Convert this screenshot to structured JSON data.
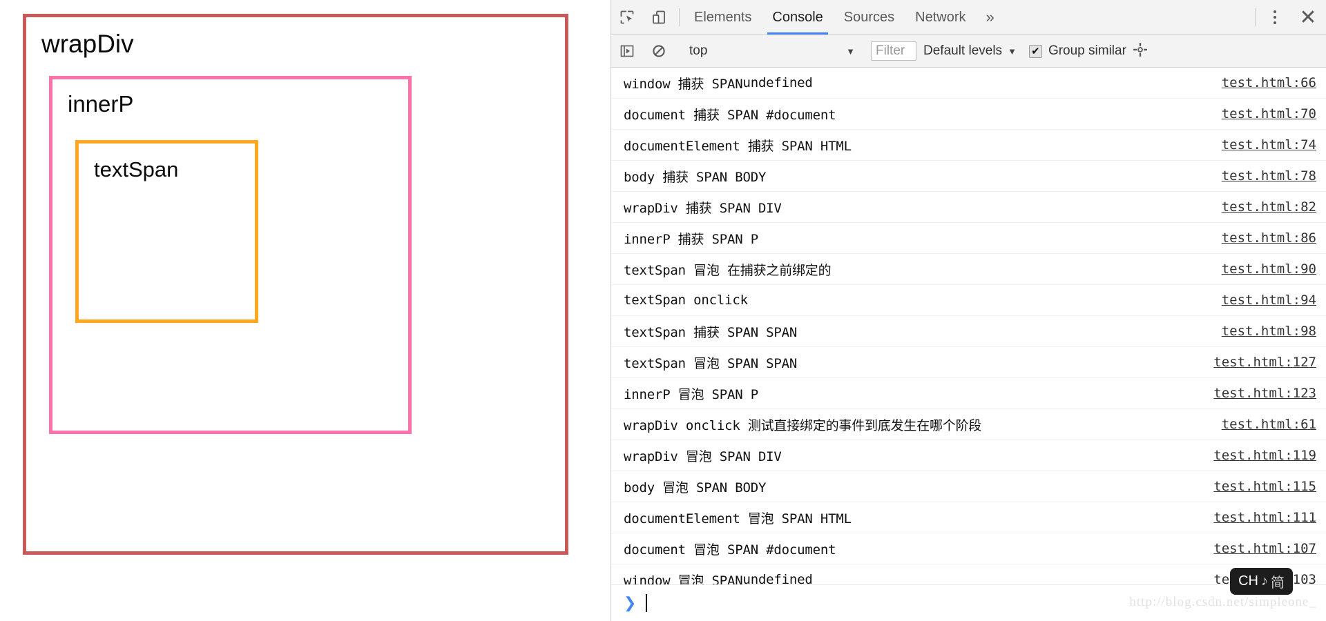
{
  "page": {
    "wrap_div_label": "wrapDiv",
    "inner_p_label": "innerP",
    "text_span_label": "textSpan",
    "colors": {
      "wrap_div_border": "#c85a5a",
      "inner_p_border": "#fc72ab",
      "text_span_border": "#ffa81e"
    }
  },
  "devtools": {
    "toolbar": {
      "inspect_icon": "inspect-element-icon",
      "device_icon": "device-toolbar-icon",
      "tabs": [
        {
          "label": "Elements",
          "selected": false
        },
        {
          "label": "Console",
          "selected": true
        },
        {
          "label": "Sources",
          "selected": false
        },
        {
          "label": "Network",
          "selected": false
        }
      ],
      "more_tabs_label": "»",
      "kebab_icon": "more-options-icon",
      "close_label": "✕",
      "accent_color": "#4285f4"
    },
    "filterbar": {
      "sidebar_toggle_icon": "console-sidebar-icon",
      "clear_icon": "clear-console-icon",
      "context": "top",
      "context_caret": "▼",
      "filter_placeholder": "Filter",
      "levels_label": "Default levels",
      "levels_caret": "▼",
      "group_similar_label": "Group similar",
      "group_similar_checked": true,
      "group_similar_check_glyph": "✔",
      "settings_icon": "settings-gear-icon"
    },
    "messages": [
      {
        "text": "window 捕获 SPAN ",
        "dim": "undefined",
        "source": "test.html:66"
      },
      {
        "text": "document 捕获 SPAN #document",
        "dim": "",
        "source": "test.html:70"
      },
      {
        "text": "documentElement 捕获 SPAN HTML",
        "dim": "",
        "source": "test.html:74"
      },
      {
        "text": "body 捕获 SPAN BODY",
        "dim": "",
        "source": "test.html:78"
      },
      {
        "text": "wrapDiv 捕获 SPAN DIV",
        "dim": "",
        "source": "test.html:82"
      },
      {
        "text": "innerP 捕获 SPAN P",
        "dim": "",
        "source": "test.html:86"
      },
      {
        "text": "textSpan 冒泡 在捕获之前绑定的",
        "dim": "",
        "source": "test.html:90"
      },
      {
        "text": "textSpan onclick",
        "dim": "",
        "source": "test.html:94"
      },
      {
        "text": "textSpan 捕获 SPAN SPAN",
        "dim": "",
        "source": "test.html:98"
      },
      {
        "text": "textSpan 冒泡 SPAN SPAN",
        "dim": "",
        "source": "test.html:127"
      },
      {
        "text": "innerP 冒泡 SPAN P",
        "dim": "",
        "source": "test.html:123"
      },
      {
        "text": "wrapDiv onclick 测试直接绑定的事件到底发生在哪个阶段",
        "dim": "",
        "source": "test.html:61"
      },
      {
        "text": "wrapDiv 冒泡 SPAN DIV",
        "dim": "",
        "source": "test.html:119"
      },
      {
        "text": "body 冒泡 SPAN BODY",
        "dim": "",
        "source": "test.html:115"
      },
      {
        "text": "documentElement 冒泡 SPAN HTML",
        "dim": "",
        "source": "test.html:111"
      },
      {
        "text": "document 冒泡 SPAN #document",
        "dim": "",
        "source": "test.html:107"
      },
      {
        "text": "window 冒泡 SPAN ",
        "dim": "undefined",
        "source": "test.html:103"
      }
    ],
    "prompt": {
      "chevron": "❯",
      "value": ""
    },
    "watermark": "http://blog.csdn.net/simpleone_",
    "ime_badge": {
      "mode": "CH",
      "punct": "♪",
      "shape": "简"
    }
  }
}
